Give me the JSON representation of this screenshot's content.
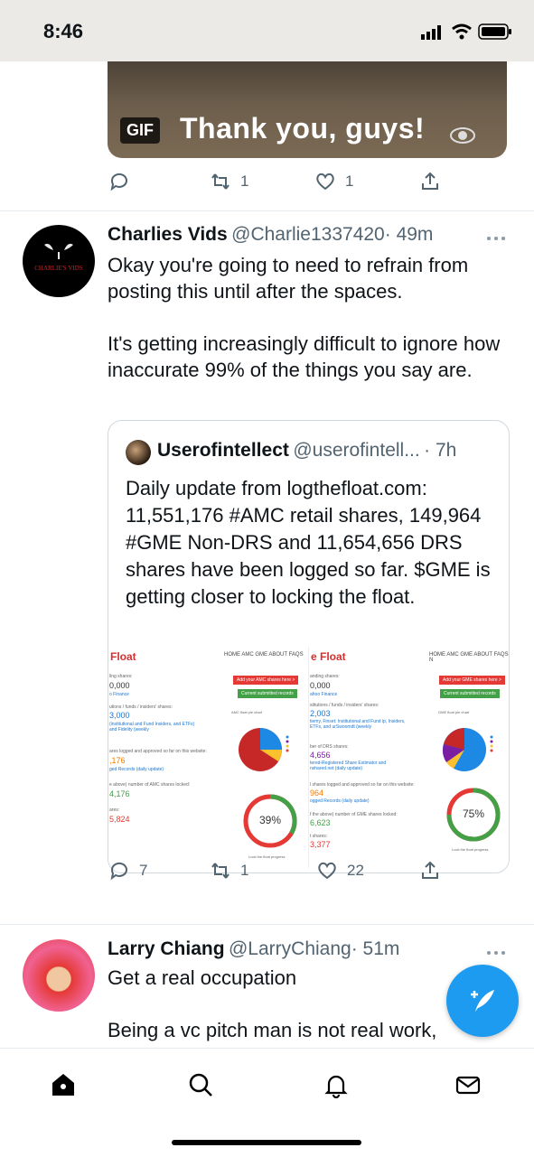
{
  "status_bar": {
    "time": "8:46"
  },
  "gif_tweet": {
    "badge": "GIF",
    "caption": "Thank you, guys!",
    "retweets": "1",
    "likes": "1"
  },
  "tweet": {
    "display_name": "Charlies Vids",
    "handle": "@Charlie1337420",
    "time": "· 49m",
    "avatar_text": "CHARLIE'S VIDS",
    "text": "Okay you're going to need to refrain from posting this until after the spaces.\n\nIt's getting increasingly difficult to ignore how inaccurate 99% of the things you say are.",
    "replies": "7",
    "retweets": "1",
    "likes": "22"
  },
  "quoted": {
    "display_name": "Userofintellect",
    "handle": "@userofintell...",
    "time": "· 7h",
    "text": "Daily update from logthefloat.com: 11,551,176 #AMC retail shares, 149,964 #GME Non-DRS and 11,654,656 DRS shares have been logged so far. $GME is getting closer to locking the float.",
    "image": {
      "left": {
        "logo": "Float",
        "nav": "HOME  AMC  GME  ABOUT  FAQS",
        "red_button": "Add your AMC shares here >",
        "green_button": "Current submitted records",
        "chart_label": "AMC float pie chart",
        "stats": [
          {
            "label": "ling shares:",
            "value": "0,000",
            "sub": "o Finance"
          },
          {
            "label": "utions / funds / insiders' shares:",
            "value": "3,000",
            "sub": "(institutional and Fund Insiders, and ETFs) and Fidelity (weekly"
          },
          {
            "label": "ares logged and approved so far on this website:",
            "value": ",176",
            "sub": "ged Records (daily update)"
          },
          {
            "label": "e above) number of AMC shares locked:",
            "value": "4,176",
            "sub": ""
          },
          {
            "label": "ares:",
            "value": "5,824",
            "sub": ""
          }
        ],
        "progress_label": "39%",
        "progress": 0.39,
        "lock_label": "Lock the float progress"
      },
      "right": {
        "logo": "e Float",
        "nav": "HOME  AMC  GME  ABOUT  FAQS  N",
        "red_button": "Add your GME shares here >",
        "green_button": "Current submitted records",
        "chart_label": "GME float pie chart",
        "stats": [
          {
            "label": "anding shares:",
            "value": "0,000",
            "sub": "ahoo Finance"
          },
          {
            "label": "stitutions / funds / insiders' shares:",
            "value": "2,003",
            "sub": "tiemy, Finset: Institutional and Fund ip, Insiders, ETFs, and urSwoomdt (weekly"
          },
          {
            "label": "ber of DRS shares:",
            "value": "4,656",
            "sub": "tered-Registered Share Estimator and nshared.net (daily update)"
          },
          {
            "label": "l shares logged and approved so far on this website:",
            "value": "964",
            "sub": "ogged Records (daily update)"
          },
          {
            "label": "f the above) number of GME shares locked:",
            "value": "6,623",
            "sub": ""
          },
          {
            "label": "t shares:",
            "value": "3,377",
            "sub": ""
          }
        ],
        "progress_label": "75%",
        "progress": 0.75,
        "lock_label": "Lock the float progress"
      }
    }
  },
  "next_tweet": {
    "display_name": "Larry Chiang",
    "handle": "@LarryChiang",
    "time": "· 51m",
    "text": "Get a real occupation\n\nBeing a vc pitch man is not real work,"
  },
  "colors": {
    "accent": "#1d9bf0",
    "text": "#0f1419",
    "muted": "#536471"
  }
}
